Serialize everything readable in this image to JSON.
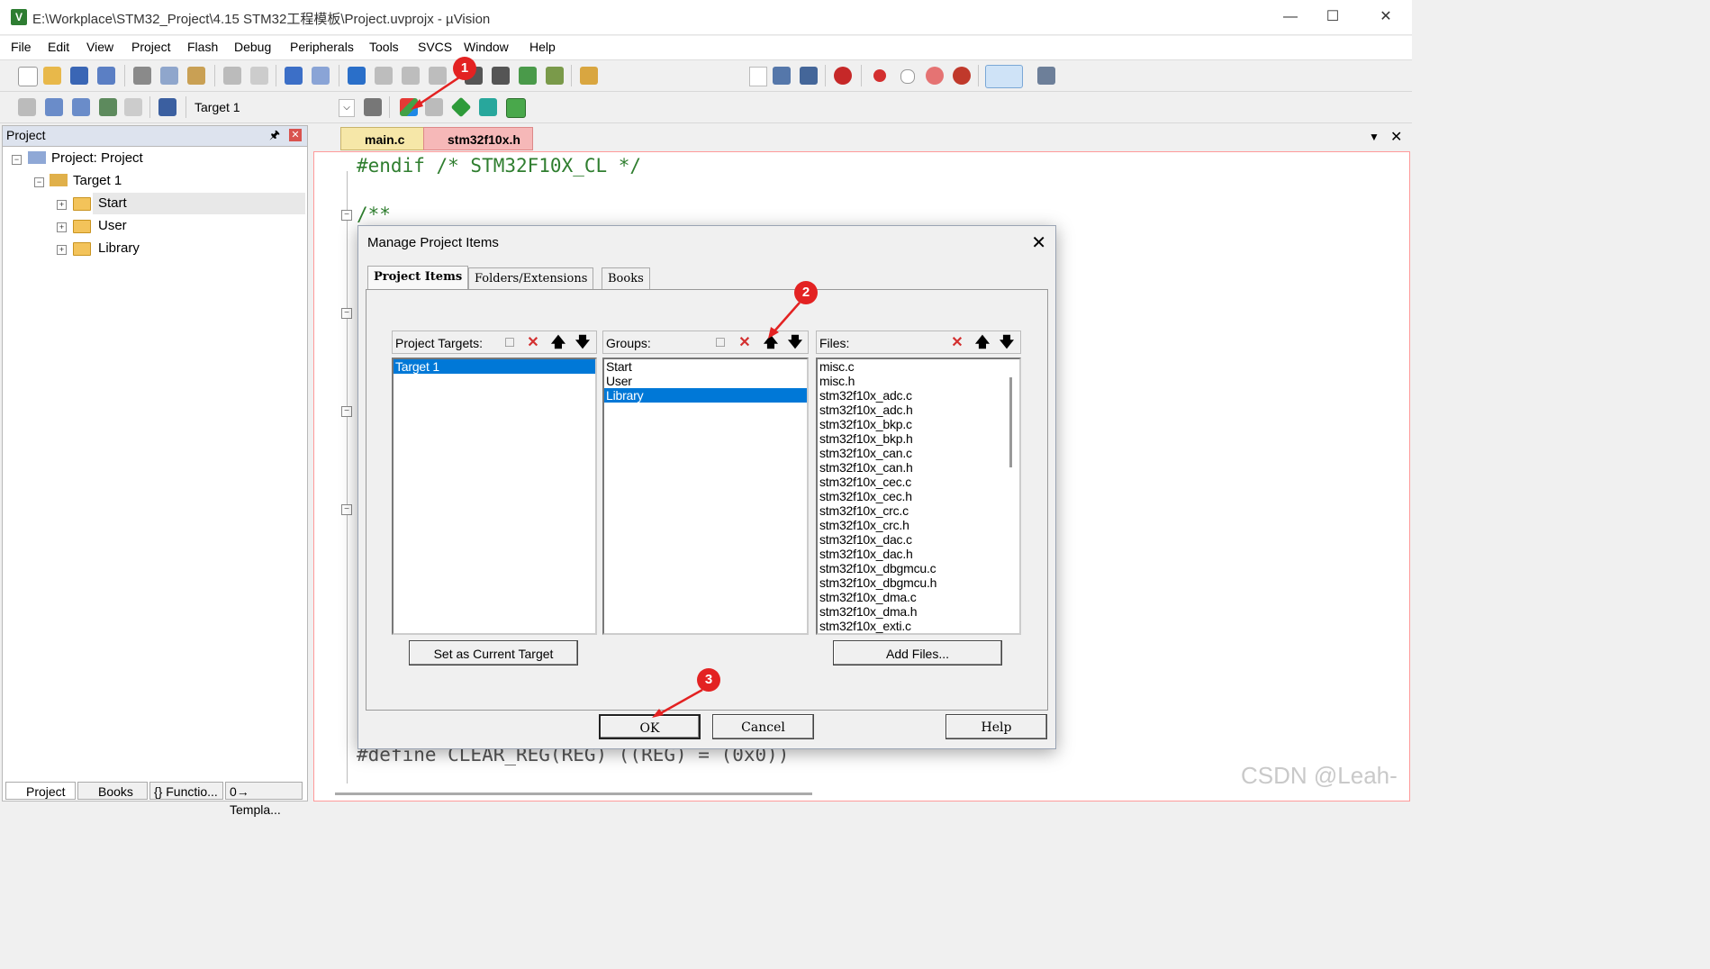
{
  "window": {
    "title": "E:\\Workplace\\STM32_Project\\4.15 STM32工程模板\\Project.uvprojx - µVision",
    "app_icon": "V"
  },
  "menu": [
    "File",
    "Edit",
    "View",
    "Project",
    "Flash",
    "Debug",
    "Peripherals",
    "Tools",
    "SVCS",
    "Window",
    "Help"
  ],
  "toolbar": {
    "target_select": "Target 1"
  },
  "project_panel": {
    "header": "Project",
    "root": "Project: Project",
    "target": "Target 1",
    "groups": [
      "Start",
      "User",
      "Library"
    ],
    "bottom_tabs": [
      "Project",
      "Books",
      "{} Functio...",
      "0→ Templa..."
    ]
  },
  "editor": {
    "tabs": [
      "main.c",
      "stm32f10x.h"
    ],
    "lines": {
      "line1": "#endif /* STM32F10X_CL */",
      "line2": "/**",
      "line3": "#define CLEAR_REG(REG)        ((REG) = (0x0))"
    }
  },
  "dialog": {
    "title": "Manage Project Items",
    "tabs": [
      "Project Items",
      "Folders/Extensions",
      "Books"
    ],
    "targets": {
      "label": "Project Targets:",
      "items": [
        "Target 1"
      ],
      "selected": "Target 1"
    },
    "groups": {
      "label": "Groups:",
      "items": [
        "Start",
        "User",
        "Library"
      ],
      "selected": "Library"
    },
    "files": {
      "label": "Files:",
      "items": [
        "misc.c",
        "misc.h",
        "stm32f10x_adc.c",
        "stm32f10x_adc.h",
        "stm32f10x_bkp.c",
        "stm32f10x_bkp.h",
        "stm32f10x_can.c",
        "stm32f10x_can.h",
        "stm32f10x_cec.c",
        "stm32f10x_cec.h",
        "stm32f10x_crc.c",
        "stm32f10x_crc.h",
        "stm32f10x_dac.c",
        "stm32f10x_dac.h",
        "stm32f10x_dbgmcu.c",
        "stm32f10x_dbgmcu.h",
        "stm32f10x_dma.c",
        "stm32f10x_dma.h",
        "stm32f10x_exti.c"
      ]
    },
    "set_current_target_button": "Set as Current Target",
    "add_files_button": "Add Files...",
    "ok_button": "OK",
    "cancel_button": "Cancel",
    "help_button": "Help"
  },
  "annotations": {
    "badge1": "1",
    "badge2": "2",
    "badge3": "3",
    "color": "#e32222"
  },
  "watermark": "CSDN @Leah-"
}
